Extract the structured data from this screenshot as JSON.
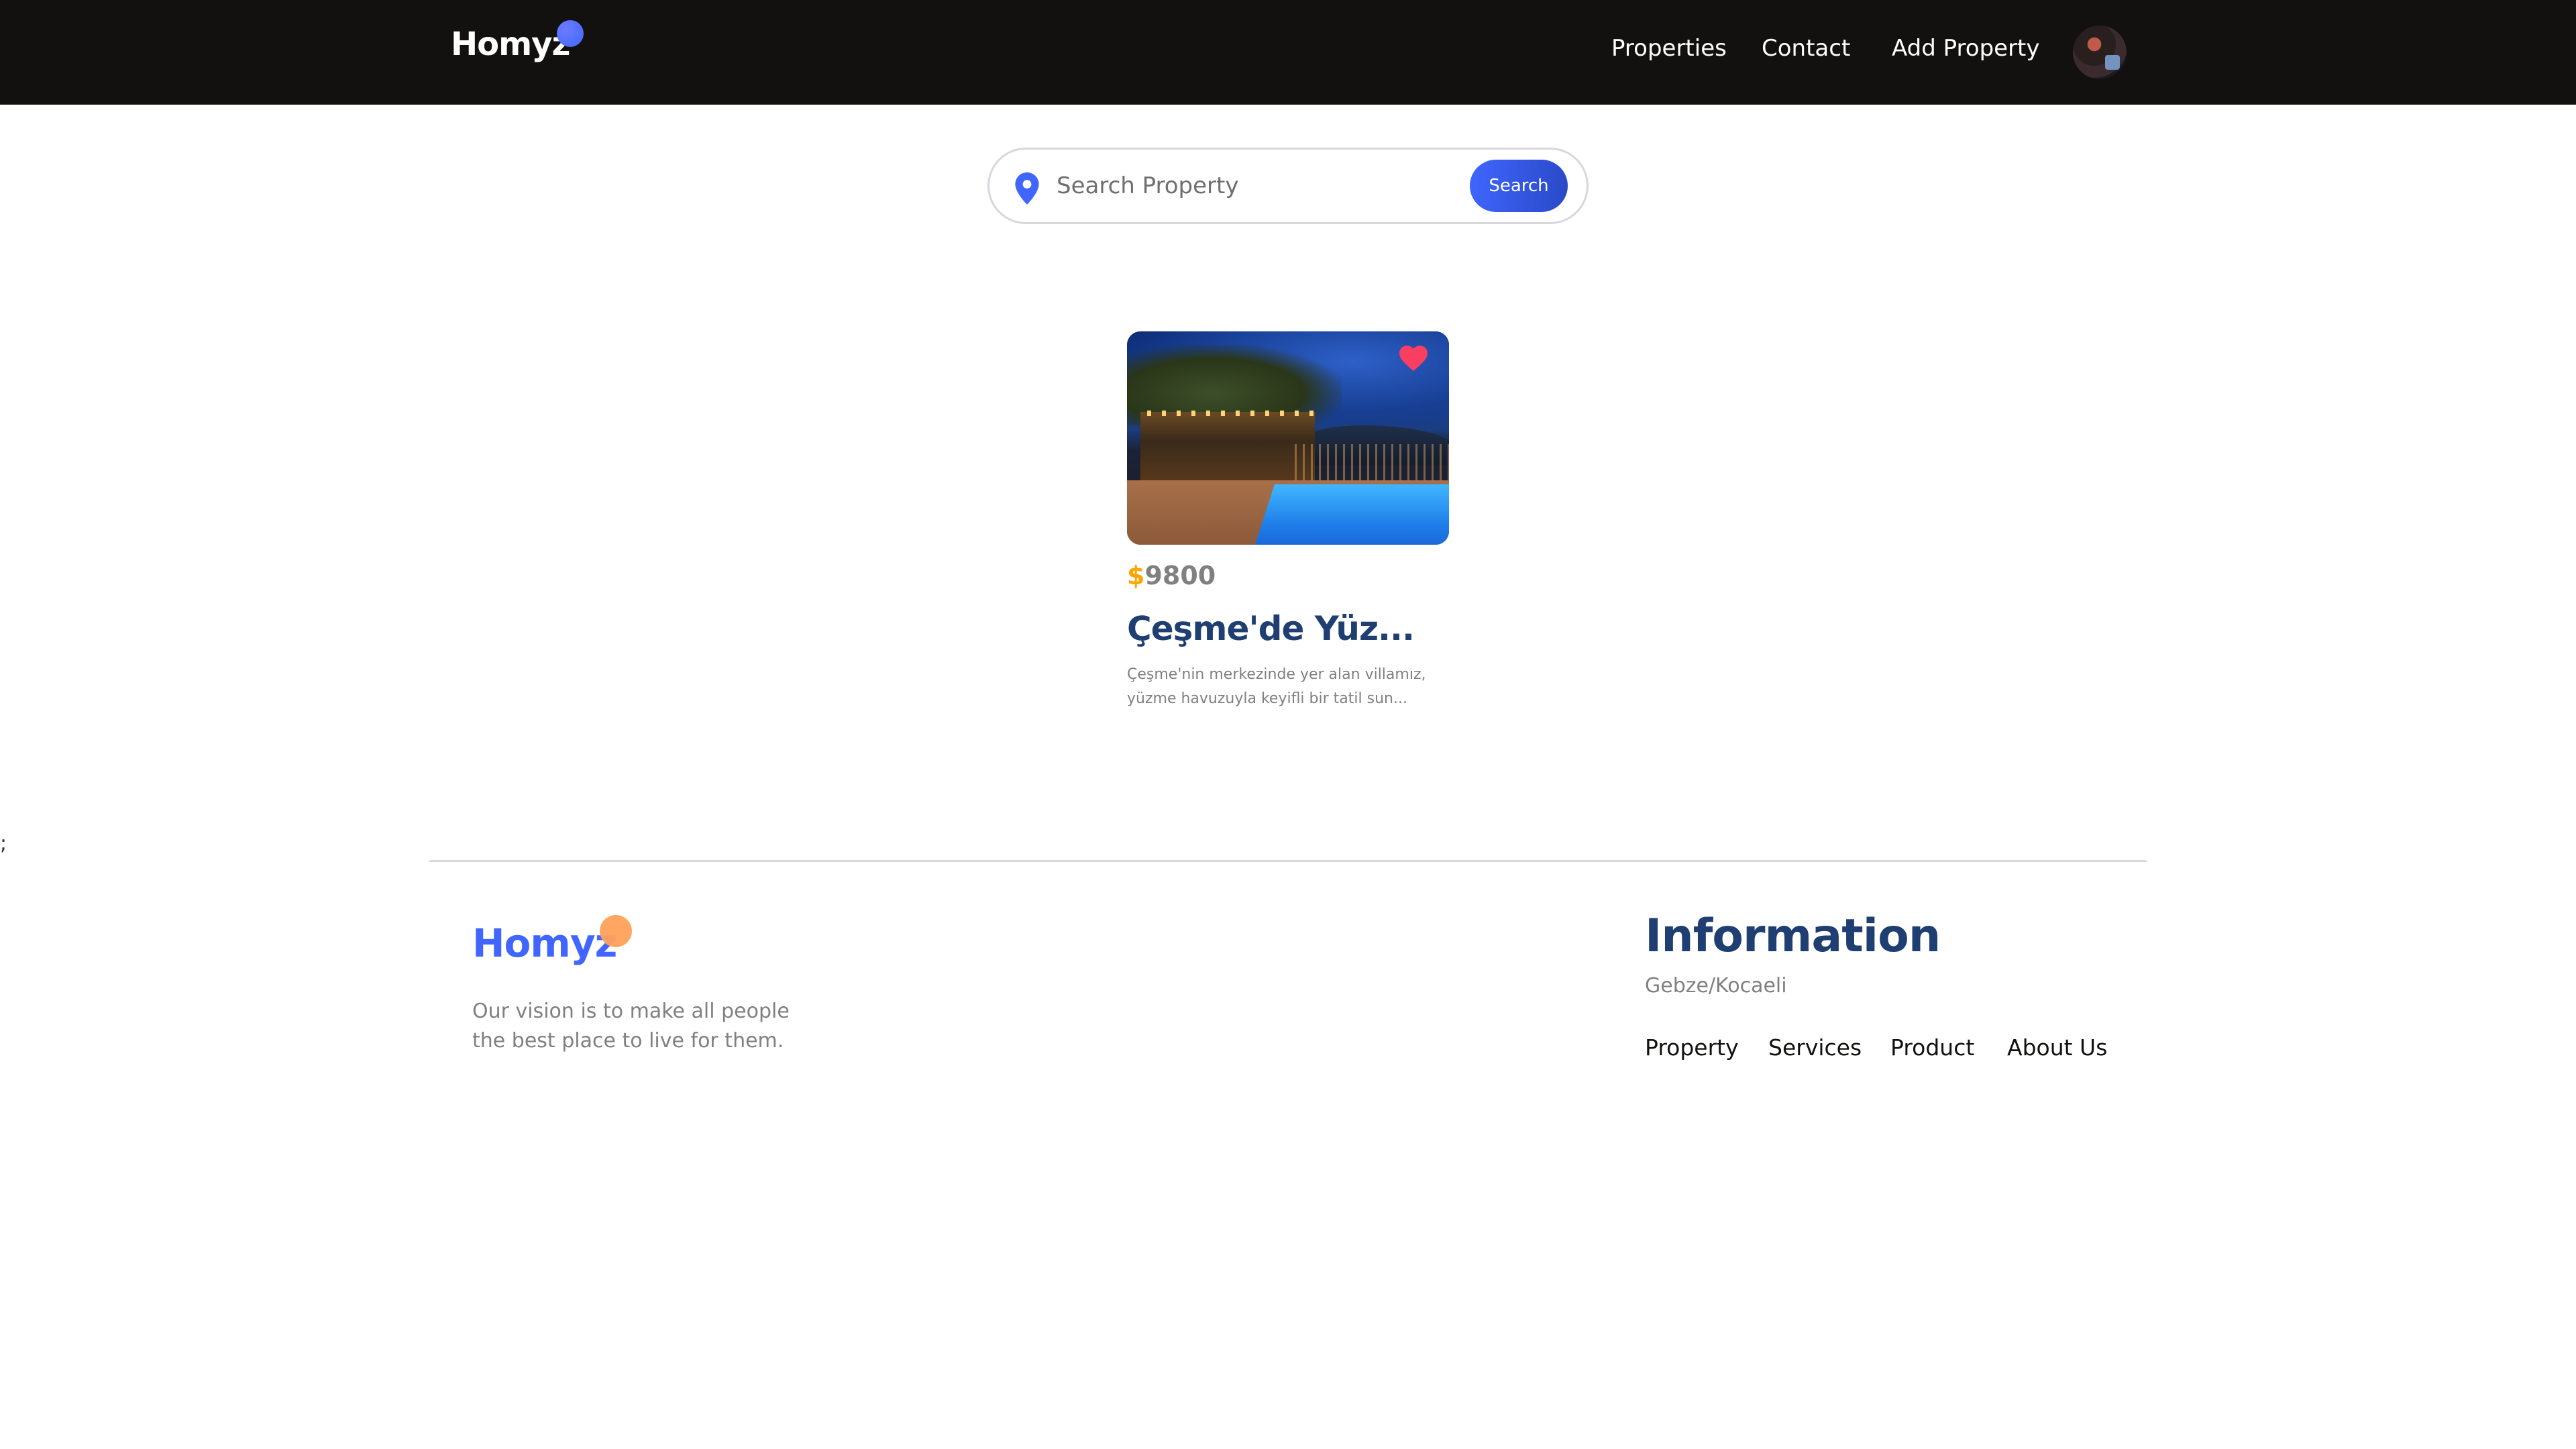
{
  "header": {
    "logo": "Homyz",
    "nav": {
      "properties": "Properties",
      "contact": "Contact",
      "add_property": "Add Property"
    },
    "avatar_icon": "user-avatar"
  },
  "search": {
    "placeholder": "Search Property",
    "value": "",
    "button_label": "Search",
    "icon": "location-pin-icon"
  },
  "listing": {
    "currency": "$",
    "price": "9800",
    "title": "Çeşme'de Yüz...",
    "description": "Çeşme'nin merkezinde yer alan villamız, yüzme havuzuyla keyifli bir tatil sun...",
    "favorite_icon": "heart-icon"
  },
  "stray_text": ";",
  "footer": {
    "logo": "Homyz",
    "vision": "Our vision is to make all people the best place to live for them.",
    "info_title": "Information",
    "address": "Gebze/Kocaeli",
    "links": {
      "property": "Property",
      "services": "Services",
      "product": "Product",
      "about": "About Us"
    }
  },
  "colors": {
    "header_bg": "#131110",
    "accent_blue": "#4066ff",
    "title_navy": "#1f3e72",
    "price_orange": "#ffa500",
    "heart_red": "#fa3e5f",
    "footer_dot": "#ffa25a"
  }
}
